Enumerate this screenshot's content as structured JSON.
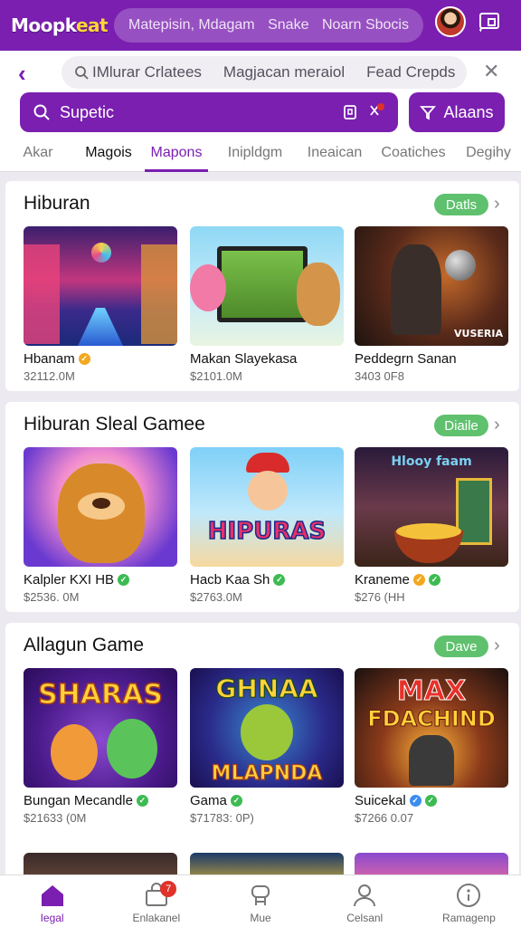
{
  "app": {
    "logo_main": "Moopk",
    "logo_accent": "eat"
  },
  "top_search": {
    "left": "Matepisin, Mdagam",
    "middle": "Snake",
    "right": "Noarn Sbocis"
  },
  "filter_bar": {
    "chips": [
      "IMlurar Crlatees",
      "Magjacan meraiol",
      "Fead Crepds"
    ]
  },
  "search": {
    "placeholder": "Supetic"
  },
  "alerts_button": {
    "label": "Alaans"
  },
  "tabs": [
    "Akar",
    "Magois",
    "Mapons",
    "Inipldgm",
    "Ineaican",
    "Coatiches",
    "Degihy"
  ],
  "sections": [
    {
      "title": "Hiburan",
      "button": "Datls",
      "cards": [
        {
          "title": "Hbanam",
          "meta": "32112.0M",
          "badges": [
            "gold"
          ]
        },
        {
          "title": "Makan Slayekasa",
          "meta": "$2101.0M",
          "badges": []
        },
        {
          "title": "Peddegrn Sanan",
          "meta": "3403 0F8",
          "badges": []
        }
      ]
    },
    {
      "title": "Hiburan Sleal Gamee",
      "button": "Diaile",
      "cards": [
        {
          "title": "Kalpler KXI HB",
          "meta": "$2536. 0M",
          "badges": [
            "green"
          ]
        },
        {
          "title": "Hacb Kaa Sh",
          "meta": "$2763.0M",
          "badges": [
            "green"
          ]
        },
        {
          "title": "Kraneme",
          "meta": "$276 (HH",
          "badges": [
            "gold",
            "green"
          ]
        }
      ]
    },
    {
      "title": "Allagun Game",
      "button": "Dave",
      "cards": [
        {
          "title": "Bungan Mecandle",
          "meta": "$21633 (0M",
          "badges": [
            "green"
          ]
        },
        {
          "title": "Gama",
          "meta": "$71783: 0P)",
          "badges": [
            "green"
          ]
        },
        {
          "title": "Suicekal",
          "meta": "$7266 0.07",
          "badges": [
            "blue",
            "green"
          ]
        }
      ]
    }
  ],
  "thumb_texts": {
    "s1c3": "VUSERIA",
    "s2c2": "HIPURAS",
    "s2c3": "Hlooy faam",
    "s3c1": "SHARAS",
    "s3c2_top": "GHNAA",
    "s3c2_bottom": "MLAPNDA",
    "s3c3_top": "MAX",
    "s3c3_bottom": "FDACHIND"
  },
  "bottom_nav": [
    {
      "label": "Iegal",
      "icon": "home-icon",
      "active": true
    },
    {
      "label": "Enlakanel",
      "icon": "store-icon",
      "badge": "7"
    },
    {
      "label": "Mue",
      "icon": "gamepad-icon"
    },
    {
      "label": "Celsanl",
      "icon": "person-icon"
    },
    {
      "label": "Ramagenp",
      "icon": "info-circle-icon"
    }
  ],
  "colors": {
    "primary": "#7a1fb0",
    "green": "#5fc16e",
    "badge_red": "#e0322b"
  }
}
